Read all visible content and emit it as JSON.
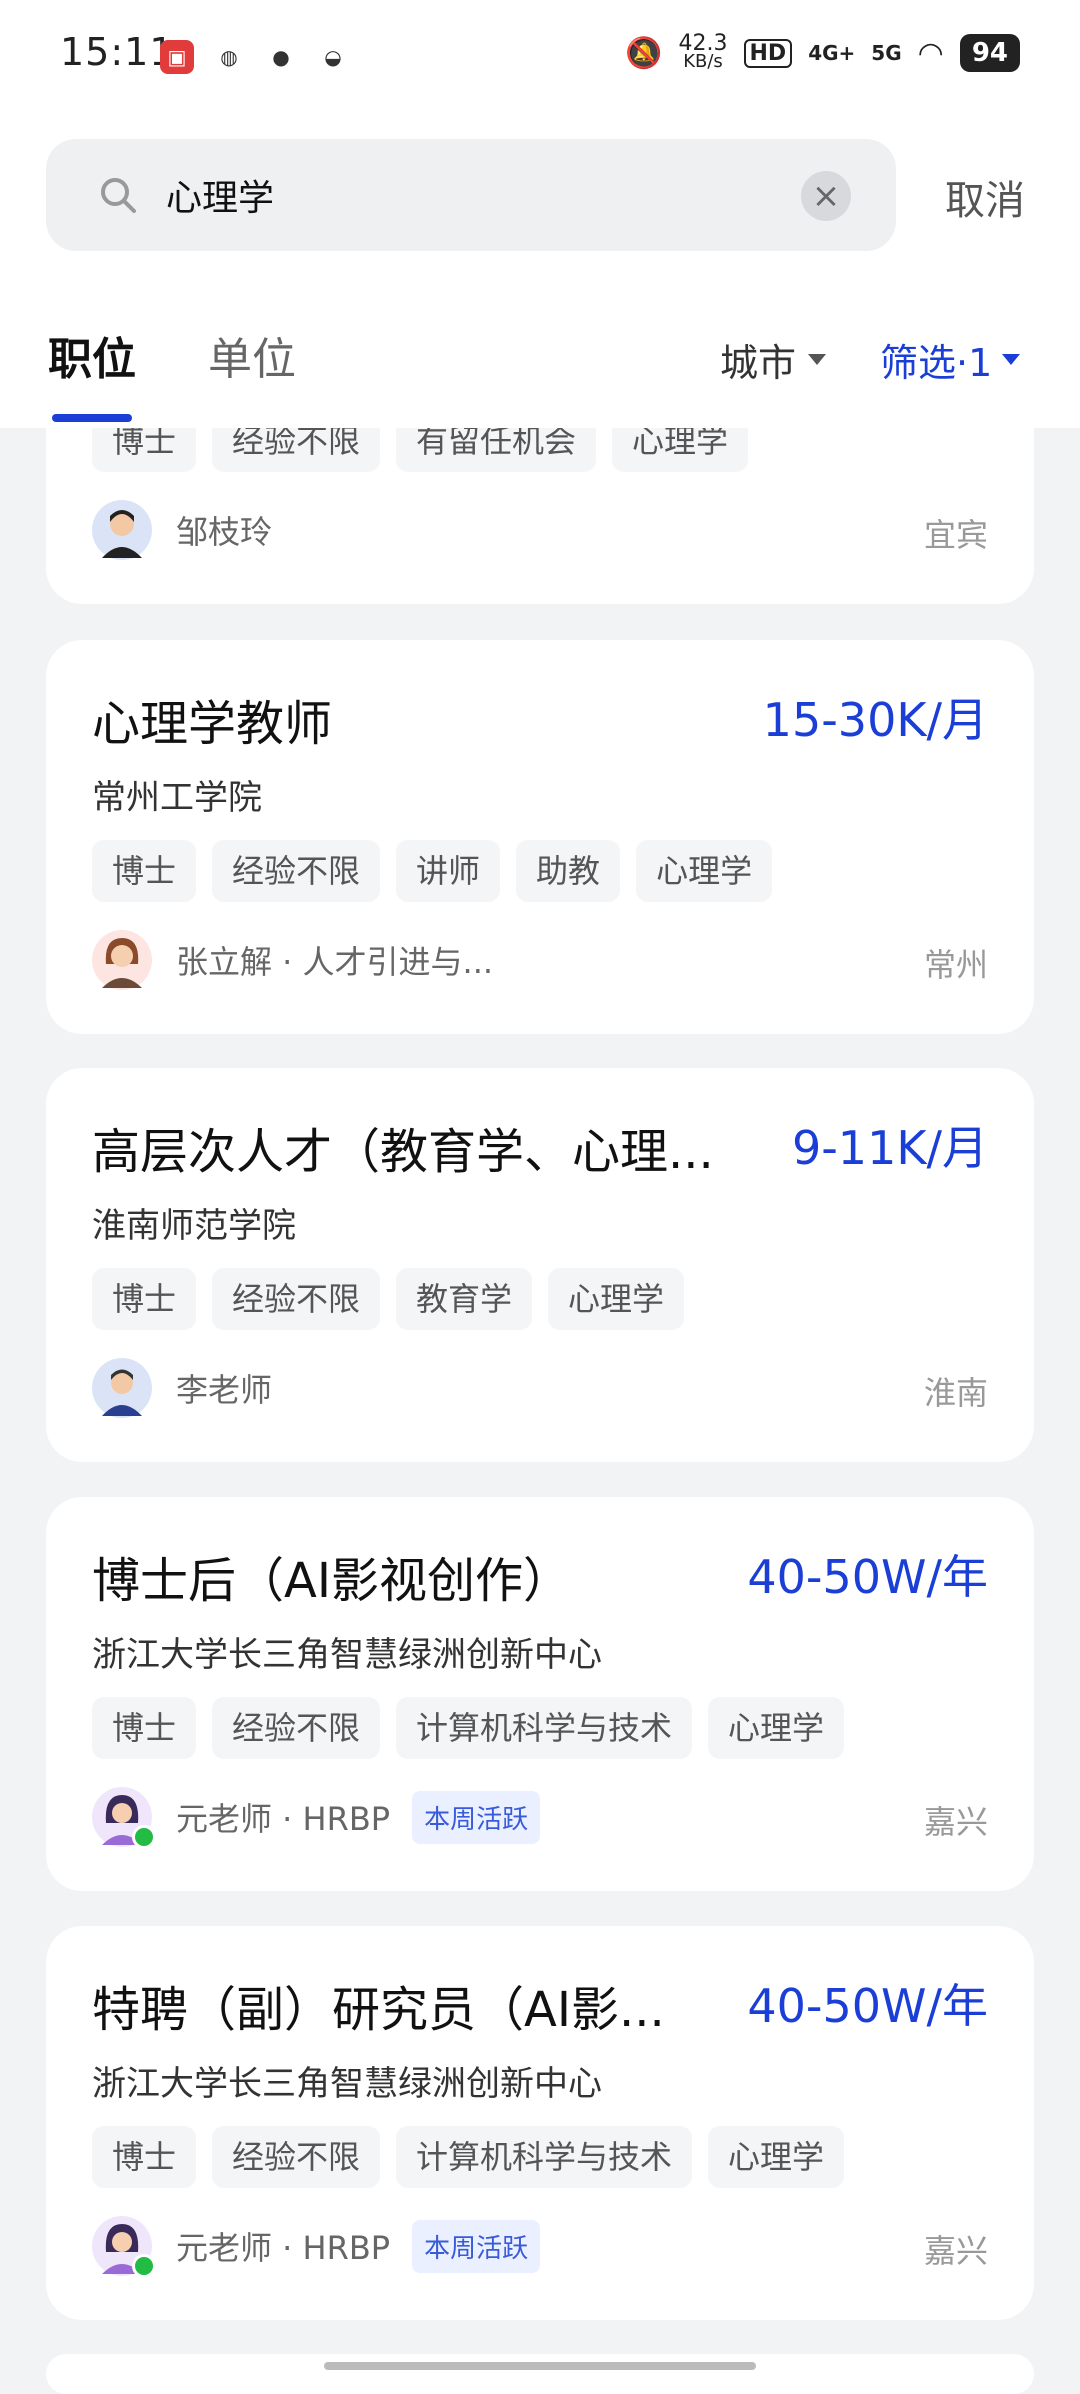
{
  "status_bar": {
    "time": "15:11",
    "net_speed_value": "42.3",
    "net_speed_unit": "KB/s",
    "hd_label": "HD",
    "sig1": "4G+",
    "sig2": "5G",
    "battery": "94"
  },
  "search": {
    "query": "心理学",
    "cancel_label": "取消"
  },
  "tabs": {
    "positions": "职位",
    "employers": "单位"
  },
  "filters": {
    "city_label": "城市",
    "filter_label": "筛选·1"
  },
  "partial_card": {
    "tags": [
      "博士",
      "经验不限",
      "有留任机会",
      "心理学"
    ],
    "recruiter": "邹枝玲",
    "city": "宜宾"
  },
  "cards": [
    {
      "title": "心理学教师",
      "salary": "15-30K/月",
      "company": "常州工学院",
      "tags": [
        "博士",
        "经验不限",
        "讲师",
        "助教",
        "心理学"
      ],
      "recruiter": "张立解 · 人才引进与...",
      "badge": "",
      "city": "常州"
    },
    {
      "title": "高层次人才（教育学、心理...",
      "salary": "9-11K/月",
      "company": "淮南师范学院",
      "tags": [
        "博士",
        "经验不限",
        "教育学",
        "心理学"
      ],
      "recruiter": "李老师",
      "badge": "",
      "city": "淮南"
    },
    {
      "title": "博士后（AI影视创作）",
      "salary": "40-50W/年",
      "company": "浙江大学长三角智慧绿洲创新中心",
      "tags": [
        "博士",
        "经验不限",
        "计算机科学与技术",
        "心理学"
      ],
      "recruiter": "元老师 · HRBP",
      "badge": "本周活跃",
      "city": "嘉兴"
    },
    {
      "title": "特聘（副）研究员（AI影...",
      "salary": "40-50W/年",
      "company": "浙江大学长三角智慧绿洲创新中心",
      "tags": [
        "博士",
        "经验不限",
        "计算机科学与技术",
        "心理学"
      ],
      "recruiter": "元老师 · HRBP",
      "badge": "本周活跃",
      "city": "嘉兴"
    }
  ],
  "colors": {
    "accent": "#1a3ed6",
    "badge_bg": "#eaf0ff",
    "online": "#22bb44"
  }
}
